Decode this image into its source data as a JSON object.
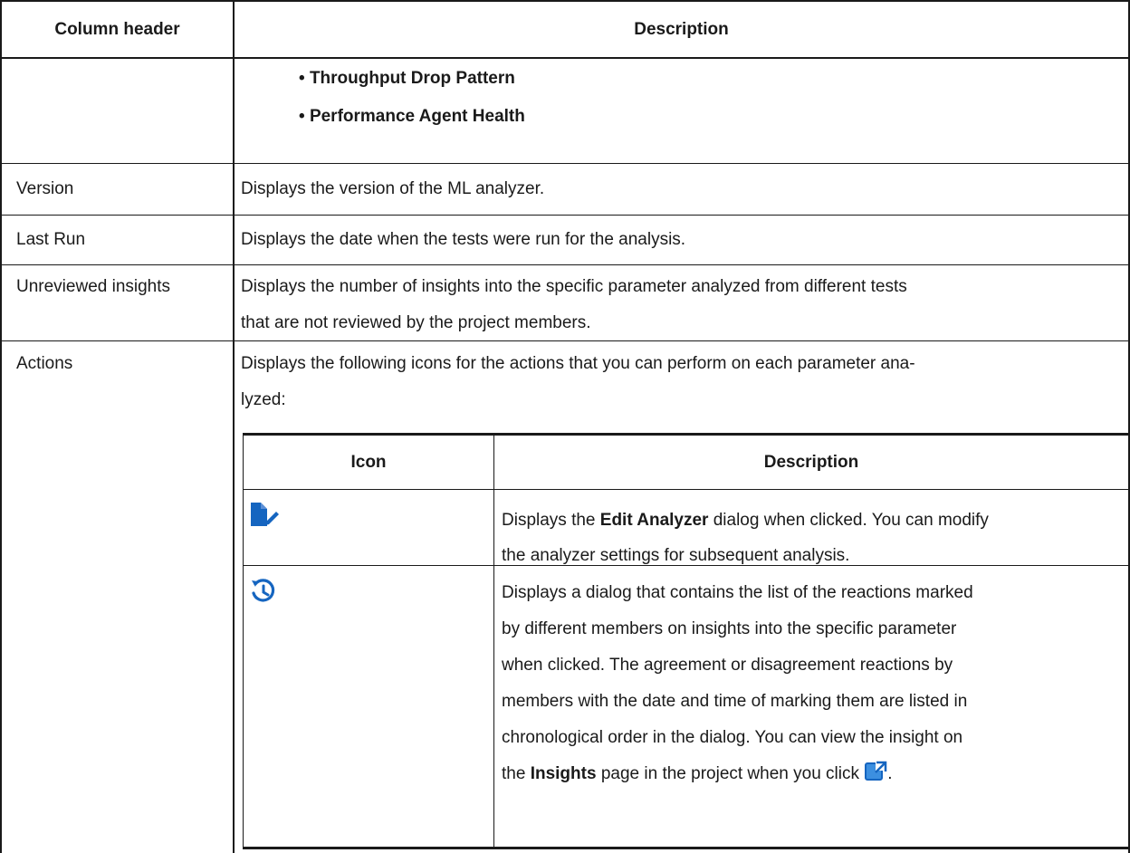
{
  "outer_table": {
    "headers": {
      "col1": "Column header",
      "col2": "Description"
    },
    "continued_row": {
      "bullets": [
        "Throughput Drop Pattern",
        "Performance Agent Health"
      ]
    },
    "rows": [
      {
        "name": "Version",
        "desc_lines": [
          "Displays the version of the ML analyzer."
        ]
      },
      {
        "name": "Last Run",
        "desc_lines": [
          "Displays the date when the tests were run for the analysis."
        ]
      },
      {
        "name": "Unreviewed insights",
        "desc_lines": [
          "Displays the number of insights into the specific parameter analyzed from different tests",
          "that are not reviewed by the project members."
        ]
      },
      {
        "name": "Actions",
        "desc_lines": [
          "Displays the following icons for the actions that you can perform on each parameter ana-",
          "lyzed:"
        ]
      }
    ]
  },
  "inner_table": {
    "headers": {
      "col1": "Icon",
      "col2": "Description"
    },
    "edit_row": {
      "icon": "edit-analyzer-icon",
      "line1_pre": "Displays the ",
      "line1_bold": "Edit Analyzer",
      "line1_post": " dialog when clicked. You can modify",
      "line2": "the analyzer settings for subsequent analysis."
    },
    "history_row": {
      "icon": "history-icon",
      "lines": [
        "Displays a dialog that contains the list of the reactions marked",
        "by different members on insights into the specific parameter",
        "when clicked. The agreement or disagreement reactions by",
        "members with the date and time of marking them are listed in",
        "chronological order in the dialog. You can view the insight on"
      ],
      "last_pre": "the ",
      "last_bold": "Insights",
      "last_post": " page in the project when you click ",
      "last_icon": "open-external-icon",
      "last_end": "."
    }
  },
  "colors": {
    "border": "#1a1a1a",
    "icon_blue": "#1565c0",
    "text": "#1a1a1a"
  }
}
